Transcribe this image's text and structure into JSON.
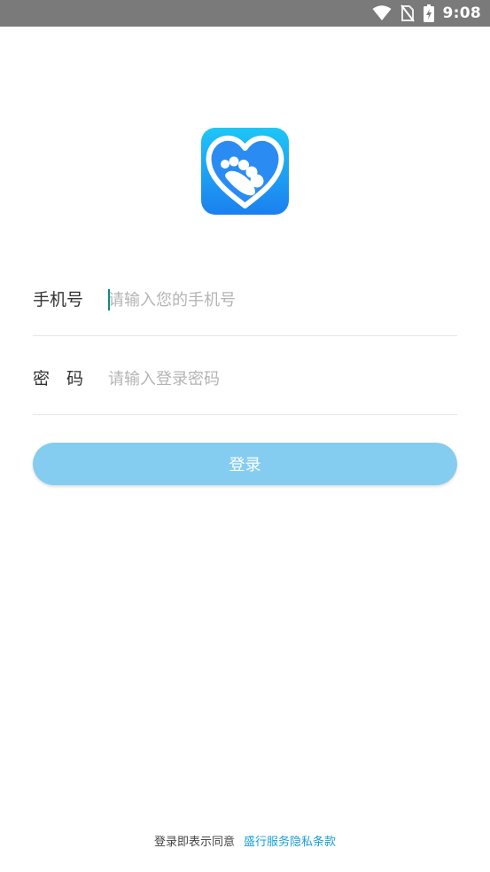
{
  "status_bar": {
    "time": "9:08",
    "icons": [
      "wifi-icon",
      "no-sim-icon",
      "battery-charging-icon"
    ]
  },
  "logo": {
    "icon": "heart-footprint-logo",
    "colors": {
      "gradient_top": "#1ec6f5",
      "gradient_bottom": "#1c7ff0",
      "heart_outline": "#ffffff"
    }
  },
  "form": {
    "phone": {
      "label": "手机号",
      "placeholder": "请输入您的手机号",
      "value": ""
    },
    "password": {
      "label": "密　码",
      "placeholder": "请输入登录密码",
      "value": ""
    },
    "login_label": "登录"
  },
  "agreement": {
    "text": "登录即表示同意",
    "link": "盛行服务隐私条款"
  },
  "colors": {
    "status_bar": "#7a7a7a",
    "button": "#84cdf0",
    "link": "#1a9ed8",
    "caret": "#0f8a82"
  }
}
